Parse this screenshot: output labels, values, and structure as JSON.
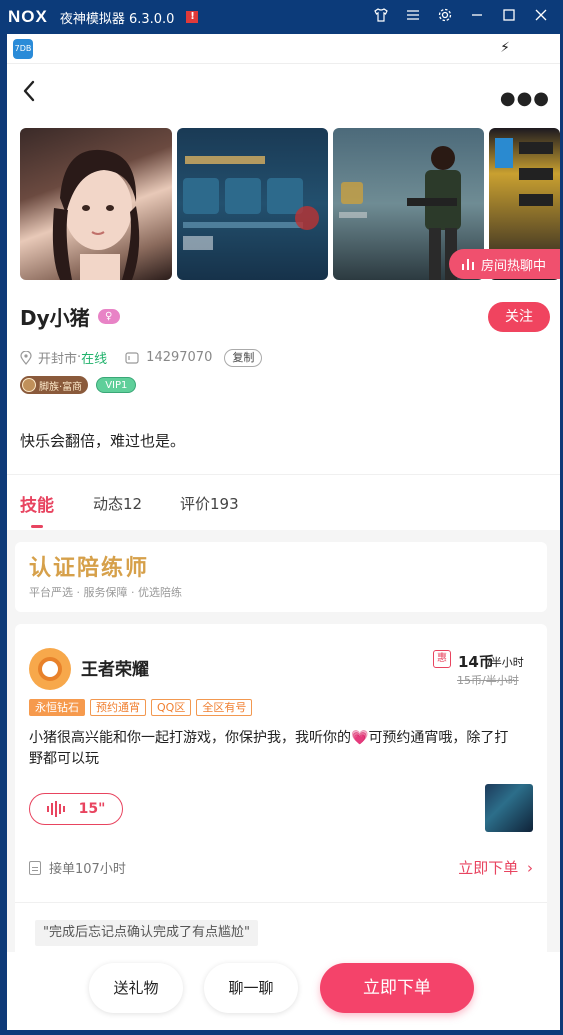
{
  "emulator": {
    "logo": "NOX",
    "title": "夜神模拟器 6.3.0.0",
    "warning_badge": "!",
    "icons": [
      "shirt-icon",
      "menu-icon",
      "gear-icon",
      "minimize-icon",
      "maximize-icon",
      "close-icon"
    ]
  },
  "status_bar": {
    "app_icon_text": "7DB"
  },
  "profile": {
    "name": "Dy小猪",
    "gender_symbol": "♀",
    "follow_label": "关注",
    "city": "开封市",
    "separator": " · ",
    "online_status": "在线",
    "id": "14297070",
    "copy_label": "复制",
    "family_badge": "脚族·富商",
    "vip_badge": "VIP1",
    "bio": "快乐会翻倍，难过也是。",
    "hot_chat_label": "房间热聊中"
  },
  "tabs": [
    {
      "label": "技能"
    },
    {
      "label": "动态12"
    },
    {
      "label": "评价193"
    }
  ],
  "certification": {
    "title": "认证陪练师",
    "subtitle": "平台严选 · 服务保障 · 优选陪练"
  },
  "skill": {
    "game": "王者荣耀",
    "discount_badge": "惠",
    "price": "14币",
    "price_unit": "/半小时",
    "original_price": "15币/半小时",
    "tags": [
      "永恒钻石",
      "预约通宵",
      "QQ区",
      "全区有号"
    ],
    "description_before": "小猪很高兴能和你一起打游戏，你保护我，我听你的",
    "description_heart": "💗",
    "description_after": "可预约通宵哦，除了打野都可以玩",
    "voice_duration": "15\"",
    "orders": "接单107小时",
    "order_link": "立即下单",
    "review_snippet": "\"完成后忘记点确认完成了有点尴尬\""
  },
  "bottom_bar": {
    "gift": "送礼物",
    "chat": "聊一聊",
    "order": "立即下单"
  },
  "colors": {
    "emulator_bar": "#0c3b7a",
    "accent": "#f0445f",
    "online": "#20b26b",
    "gold": "#d6a04a",
    "tag_orange": "#f07f30"
  }
}
